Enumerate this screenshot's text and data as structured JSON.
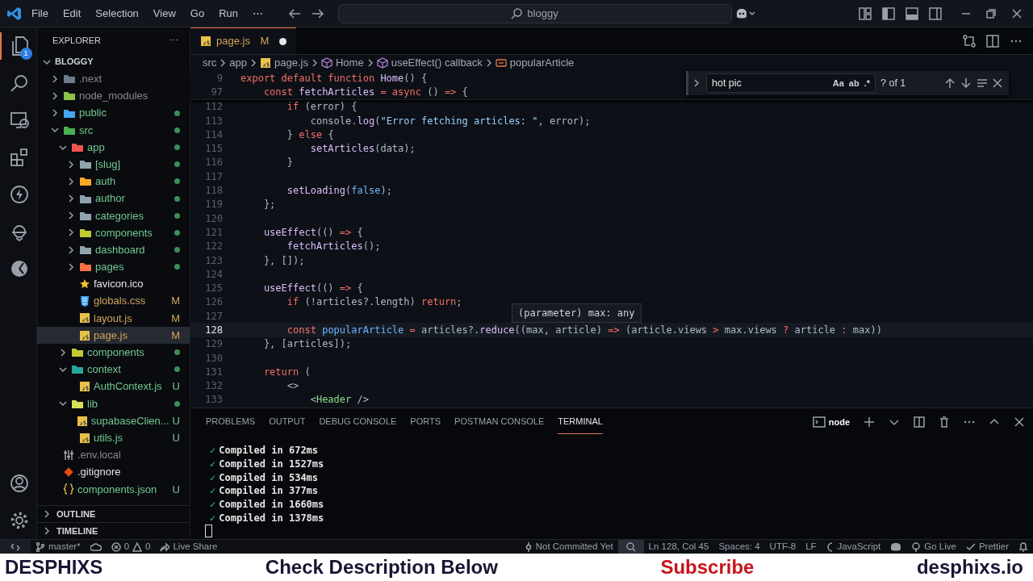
{
  "title_bar": {
    "menus": [
      "File",
      "Edit",
      "Selection",
      "View",
      "Go",
      "Run",
      "⋯"
    ],
    "command_center": "bloggy"
  },
  "activity_bar": {
    "badge": "1"
  },
  "explorer": {
    "title": "EXPLORER",
    "more": "⋯",
    "root": "BLOGGY",
    "tree": [
      {
        "name": ".next",
        "kind": "folder",
        "color": "#6b7b8c",
        "ignored": true,
        "untracked": false,
        "modified": false,
        "expanded": false,
        "changed": false
      },
      {
        "name": "node_modules",
        "kind": "folder",
        "color": "#8bc34a",
        "ignored": true,
        "untracked": false,
        "modified": false,
        "expanded": false,
        "changed": false
      },
      {
        "name": "public",
        "kind": "folder",
        "color": "#42a5f5",
        "ignored": false,
        "untracked": true,
        "modified": false,
        "expanded": false,
        "changed": true
      },
      {
        "name": "src",
        "kind": "folder",
        "color": "#4caf50",
        "ignored": false,
        "untracked": true,
        "modified": false,
        "expanded": true,
        "changed": true,
        "children": [
          {
            "name": "app",
            "kind": "folder",
            "color": "#ef5350",
            "ignored": false,
            "untracked": true,
            "modified": false,
            "expanded": true,
            "changed": true,
            "children": [
              {
                "name": "[slug]",
                "kind": "folder",
                "color": "#90a4ae",
                "ignored": false,
                "untracked": true,
                "modified": false,
                "expanded": false,
                "changed": true
              },
              {
                "name": "auth",
                "kind": "folder",
                "color": "#ffa726",
                "ignored": false,
                "untracked": true,
                "modified": false,
                "expanded": false,
                "changed": true
              },
              {
                "name": "author",
                "kind": "folder",
                "color": "#90a4ae",
                "ignored": false,
                "untracked": true,
                "modified": false,
                "expanded": false,
                "changed": true
              },
              {
                "name": "categories",
                "kind": "folder",
                "color": "#90a4ae",
                "ignored": false,
                "untracked": true,
                "modified": false,
                "expanded": false,
                "changed": true
              },
              {
                "name": "components",
                "kind": "folder",
                "color": "#c0ca33",
                "ignored": false,
                "untracked": true,
                "modified": false,
                "expanded": false,
                "changed": true
              },
              {
                "name": "dashboard",
                "kind": "folder",
                "color": "#90a4ae",
                "ignored": false,
                "untracked": true,
                "modified": false,
                "expanded": false,
                "changed": true
              },
              {
                "name": "pages",
                "kind": "folder",
                "color": "#ff7043",
                "ignored": false,
                "untracked": true,
                "modified": false,
                "expanded": false,
                "changed": true
              },
              {
                "name": "favicon.ico",
                "kind": "star",
                "ignored": false,
                "untracked": false,
                "modified": false,
                "selected": false
              },
              {
                "name": "globals.css",
                "kind": "css",
                "ignored": false,
                "untracked": false,
                "modified": true,
                "git": "M",
                "selected": false
              },
              {
                "name": "layout.js",
                "kind": "js",
                "ignored": false,
                "untracked": false,
                "modified": true,
                "git": "M",
                "selected": false
              },
              {
                "name": "page.js",
                "kind": "js",
                "ignored": false,
                "untracked": false,
                "modified": true,
                "git": "M",
                "selected": true
              }
            ]
          },
          {
            "name": "components",
            "kind": "folder",
            "color": "#c0ca33",
            "ignored": false,
            "untracked": true,
            "modified": false,
            "expanded": false,
            "changed": true
          },
          {
            "name": "context",
            "kind": "folder",
            "color": "#26a69a",
            "ignored": false,
            "untracked": true,
            "modified": false,
            "expanded": true,
            "changed": true,
            "children": [
              {
                "name": "AuthContext.js",
                "kind": "js",
                "ignored": false,
                "untracked": true,
                "modified": false,
                "git": "U",
                "selected": false
              }
            ]
          },
          {
            "name": "lib",
            "kind": "folder",
            "color": "#d4e157",
            "ignored": false,
            "untracked": true,
            "modified": false,
            "expanded": true,
            "changed": true,
            "children": [
              {
                "name": "supabaseClien...",
                "kind": "js",
                "ignored": false,
                "untracked": true,
                "modified": false,
                "git": "U",
                "selected": false
              },
              {
                "name": "utils.js",
                "kind": "js",
                "ignored": false,
                "untracked": true,
                "modified": false,
                "git": "U",
                "selected": false
              }
            ]
          }
        ]
      },
      {
        "name": ".env.local",
        "kind": "env",
        "ignored": true,
        "untracked": false,
        "modified": false,
        "selected": false
      },
      {
        "name": ".gitignore",
        "kind": "git",
        "ignored": false,
        "untracked": false,
        "modified": false,
        "selected": false
      },
      {
        "name": "components.json",
        "kind": "json",
        "ignored": false,
        "untracked": true,
        "modified": false,
        "git": "U",
        "selected": false
      }
    ],
    "sections": [
      "OUTLINE",
      "TIMELINE"
    ]
  },
  "editor": {
    "tab": {
      "name": "page.js",
      "git": "M",
      "dirty": true
    },
    "breadcrumbs": [
      {
        "label": "src",
        "kind": "text"
      },
      {
        "label": "app",
        "kind": "text"
      },
      {
        "label": "page.js",
        "kind": "js"
      },
      {
        "label": "Home",
        "kind": "symbol"
      },
      {
        "label": "useEffect() callback",
        "kind": "symbol"
      },
      {
        "label": "popularArticle",
        "kind": "variable"
      }
    ],
    "find": {
      "value": "hot pic",
      "options": [
        "Aa",
        "ab",
        ".*"
      ],
      "result": "? of 1"
    },
    "sticky": [
      {
        "n": "9",
        "tokens": [
          {
            "kind": "kw",
            "text": "export default function "
          },
          {
            "kind": "fn",
            "text": "Home"
          },
          {
            "kind": "p",
            "text": "() {"
          }
        ]
      },
      {
        "n": "97",
        "tokens": [
          {
            "kind": "kw",
            "text": "    const "
          },
          {
            "kind": "fn",
            "text": "fetchArticles"
          },
          {
            "kind": "kw",
            "text": " = async "
          },
          {
            "kind": "p",
            "text": "() "
          },
          {
            "kind": "kw",
            "text": "=> "
          },
          {
            "kind": "p",
            "text": "{"
          }
        ]
      }
    ],
    "lines": [
      {
        "n": "112",
        "current": false,
        "tokens": [
          {
            "kind": "kw",
            "text": "        if "
          },
          {
            "kind": "p",
            "text": "("
          },
          {
            "kind": "v",
            "text": "error"
          },
          {
            "kind": "p",
            "text": ") {"
          }
        ]
      },
      {
        "n": "113",
        "current": false,
        "tokens": [
          {
            "kind": "v",
            "text": "            console"
          },
          {
            "kind": "p",
            "text": "."
          },
          {
            "kind": "fn",
            "text": "log"
          },
          {
            "kind": "p",
            "text": "("
          },
          {
            "kind": "str",
            "text": "\"Error fetching articles: \""
          },
          {
            "kind": "p",
            "text": ", "
          },
          {
            "kind": "v",
            "text": "error"
          },
          {
            "kind": "p",
            "text": ");"
          }
        ]
      },
      {
        "n": "114",
        "current": false,
        "tokens": [
          {
            "kind": "p",
            "text": "        } "
          },
          {
            "kind": "kw",
            "text": "else "
          },
          {
            "kind": "p",
            "text": "{"
          }
        ]
      },
      {
        "n": "115",
        "current": false,
        "tokens": [
          {
            "kind": "fn",
            "text": "            setArticles"
          },
          {
            "kind": "p",
            "text": "("
          },
          {
            "kind": "v",
            "text": "data"
          },
          {
            "kind": "p",
            "text": ");"
          }
        ]
      },
      {
        "n": "116",
        "current": false,
        "tokens": [
          {
            "kind": "p",
            "text": "        }"
          }
        ]
      },
      {
        "n": "117",
        "current": false
      },
      {
        "n": "118",
        "current": false,
        "tokens": [
          {
            "kind": "fn",
            "text": "        setLoading"
          },
          {
            "kind": "p",
            "text": "("
          },
          {
            "kind": "c",
            "text": "false"
          },
          {
            "kind": "p",
            "text": ");"
          }
        ]
      },
      {
        "n": "119",
        "current": false,
        "tokens": [
          {
            "kind": "p",
            "text": "    };"
          }
        ]
      },
      {
        "n": "120",
        "current": false
      },
      {
        "n": "121",
        "current": false,
        "tokens": [
          {
            "kind": "fn",
            "text": "    useEffect"
          },
          {
            "kind": "p",
            "text": "(() "
          },
          {
            "kind": "kw",
            "text": "=> "
          },
          {
            "kind": "p",
            "text": "{"
          }
        ]
      },
      {
        "n": "122",
        "current": false,
        "tokens": [
          {
            "kind": "fn",
            "text": "        fetchArticles"
          },
          {
            "kind": "p",
            "text": "();"
          }
        ]
      },
      {
        "n": "123",
        "current": false,
        "tokens": [
          {
            "kind": "p",
            "text": "    }, []);"
          }
        ]
      },
      {
        "n": "124",
        "current": false
      },
      {
        "n": "125",
        "current": false,
        "tokens": [
          {
            "kind": "fn",
            "text": "    useEffect"
          },
          {
            "kind": "p",
            "text": "(() "
          },
          {
            "kind": "kw",
            "text": "=> "
          },
          {
            "kind": "p",
            "text": "{"
          }
        ]
      },
      {
        "n": "126",
        "current": false,
        "tokens": [
          {
            "kind": "kw",
            "text": "        if "
          },
          {
            "kind": "p",
            "text": "(!"
          },
          {
            "kind": "v",
            "text": "articles"
          },
          {
            "kind": "p",
            "text": "?."
          },
          {
            "kind": "v",
            "text": "length"
          },
          {
            "kind": "p",
            "text": ") "
          },
          {
            "kind": "kw",
            "text": "return"
          },
          {
            "kind": "p",
            "text": ";"
          }
        ]
      },
      {
        "n": "127",
        "current": false
      },
      {
        "n": "128",
        "current": true,
        "tokens": [
          {
            "kind": "kw",
            "text": "        const "
          },
          {
            "kind": "c",
            "text": "popularArticle"
          },
          {
            "kind": "kw",
            "text": " = "
          },
          {
            "kind": "v",
            "text": "articles"
          },
          {
            "kind": "p",
            "text": "?."
          },
          {
            "kind": "fn",
            "text": "reduce"
          },
          {
            "kind": "p",
            "text": "(("
          },
          {
            "kind": "v",
            "text": "max"
          },
          {
            "kind": "p",
            "text": ", "
          },
          {
            "kind": "v",
            "text": "article"
          },
          {
            "kind": "p",
            "text": ") "
          },
          {
            "kind": "kw",
            "text": "=> "
          },
          {
            "kind": "p",
            "text": "("
          },
          {
            "kind": "v",
            "text": "article"
          },
          {
            "kind": "p",
            "text": "."
          },
          {
            "kind": "v",
            "text": "views"
          },
          {
            "kind": "kw",
            "text": " > "
          },
          {
            "kind": "v",
            "text": "max"
          },
          {
            "kind": "p",
            "text": "."
          },
          {
            "kind": "v",
            "text": "views"
          },
          {
            "kind": "kw",
            "text": " ? "
          },
          {
            "kind": "v",
            "text": "article"
          },
          {
            "kind": "kw",
            "text": " : "
          },
          {
            "kind": "v",
            "text": "max"
          },
          {
            "kind": "p",
            "text": "))"
          }
        ]
      },
      {
        "n": "129",
        "current": false,
        "tokens": [
          {
            "kind": "p",
            "text": "    }, ["
          },
          {
            "kind": "v",
            "text": "articles"
          },
          {
            "kind": "p",
            "text": "]);"
          }
        ]
      },
      {
        "n": "130",
        "current": false
      },
      {
        "n": "131",
        "current": false,
        "tokens": [
          {
            "kind": "kw",
            "text": "    return "
          },
          {
            "kind": "p",
            "text": "("
          }
        ]
      },
      {
        "n": "132",
        "current": false,
        "tokens": [
          {
            "kind": "p",
            "text": "        <>"
          }
        ]
      },
      {
        "n": "133",
        "current": false,
        "tokens": [
          {
            "kind": "p",
            "text": "            <"
          },
          {
            "kind": "tag",
            "text": "Header"
          },
          {
            "kind": "p",
            "text": " />"
          }
        ]
      }
    ],
    "hover": "(parameter) max: any"
  },
  "panel": {
    "tabs": [
      {
        "label": "PROBLEMS",
        "selected": false
      },
      {
        "label": "OUTPUT",
        "selected": false
      },
      {
        "label": "DEBUG CONSOLE",
        "selected": false
      },
      {
        "label": "PORTS",
        "selected": false
      },
      {
        "label": "POSTMAN CONSOLE",
        "selected": false
      },
      {
        "label": "TERMINAL",
        "selected": true
      }
    ],
    "shell": "node",
    "terminal": [
      {
        "mark": "✓",
        "text": "Compiled in 672ms"
      },
      {
        "mark": "✓",
        "text": "Compiled in 1527ms"
      },
      {
        "mark": "✓",
        "text": "Compiled in 534ms"
      },
      {
        "mark": "✓",
        "text": "Compiled in 377ms"
      },
      {
        "mark": "✓",
        "text": "Compiled in 1660ms"
      },
      {
        "mark": "✓",
        "text": "Compiled in 1378ms"
      }
    ]
  },
  "status_bar": {
    "branch": "master*",
    "errors": "0",
    "warnings": "0",
    "live_share": "Live Share",
    "blame": "Not Committed Yet",
    "position": "Ln 128, Col 45",
    "spaces": "Spaces: 4",
    "encoding": "UTF-8",
    "eol": "LF",
    "language": "JavaScript",
    "go_live": "Go Live",
    "prettier": "Prettier"
  },
  "banner": [
    {
      "text": "DESPHIXS",
      "kind": "brand"
    },
    {
      "text": "Check Description Below",
      "kind": "plain"
    },
    {
      "text": "Subscribe",
      "kind": "accent"
    },
    {
      "text": "desphixs.io",
      "kind": "brand"
    }
  ]
}
